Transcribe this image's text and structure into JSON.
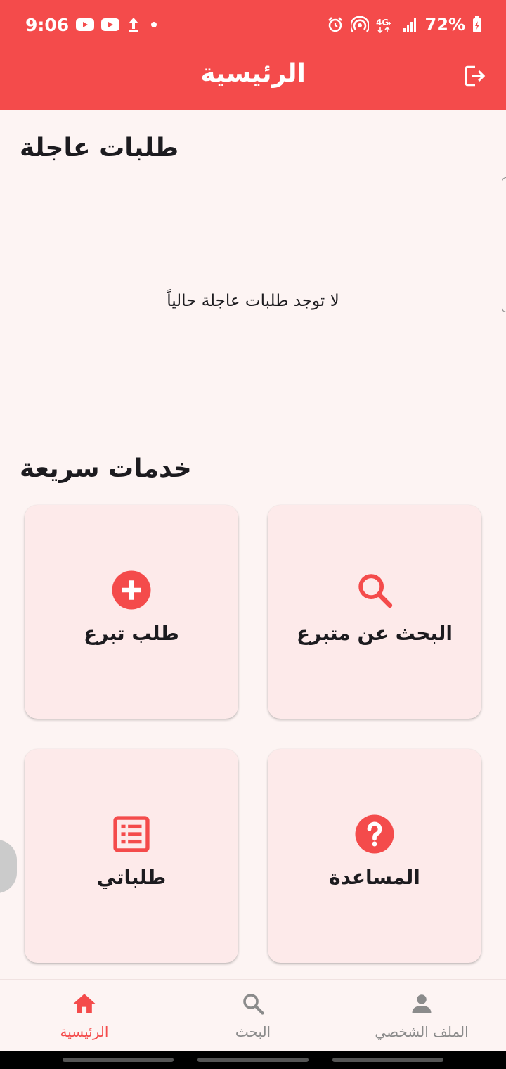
{
  "status_bar": {
    "time": "9:06",
    "battery": "72%",
    "icons": [
      "youtube-icon",
      "youtube-icon",
      "upload-icon",
      "dot-icon",
      "alarm-icon",
      "hotspot-icon",
      "4g-icon",
      "signal-icon",
      "battery-icon"
    ]
  },
  "app_bar": {
    "title": "الرئيسية",
    "logout_icon": "logout-icon"
  },
  "urgent": {
    "title": "طلبات عاجلة",
    "empty_message": "لا توجد طلبات عاجلة حالياً"
  },
  "quick": {
    "title": "خدمات سريعة",
    "cards": [
      {
        "label": "البحث عن متبرع",
        "icon": "search-icon"
      },
      {
        "label": "طلب تبرع",
        "icon": "add-circle-icon"
      },
      {
        "label": "المساعدة",
        "icon": "help-icon"
      },
      {
        "label": "طلباتي",
        "icon": "list-icon"
      }
    ]
  },
  "bottom_nav": {
    "items": [
      {
        "label": "الرئيسية",
        "icon": "home-icon",
        "active": true
      },
      {
        "label": "البحث",
        "icon": "search-icon",
        "active": false
      },
      {
        "label": "الملف الشخصي",
        "icon": "person-icon",
        "active": false
      }
    ]
  },
  "colors": {
    "primary": "#f44b4b",
    "background": "#fdf4f3",
    "card": "#fdeaea",
    "inactive": "#8b8b8b"
  }
}
